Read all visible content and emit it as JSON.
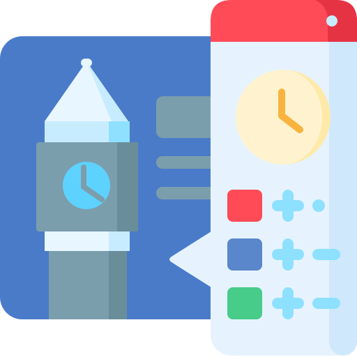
{
  "icon": {
    "name": "big-ben-time-zone-icon",
    "subject": "clock-tower-with-color-legend-panel"
  },
  "colors": {
    "card_blue": "#4a7bc9",
    "card_blue_dark": "#3f6fbf",
    "panel_bg": "#e6f3ff",
    "panel_shadow": "#cfe8fb",
    "panel_header": "#ff4b57",
    "panel_header_dark": "#e53344",
    "tower_stone": "#7b9ead",
    "tower_stone_dark": "#698e9a",
    "tower_light": "#c8ecff",
    "tower_top": "#e8f6ff",
    "clock_face": "#fff3cf",
    "clock_face_shade": "#ffe9a8",
    "clock_hands": "#f8b33e",
    "tower_clock": "#5ed2ff",
    "tower_clock_light": "#8fe0ff",
    "legend_red": "#ff4b57",
    "legend_blue": "#5a87cc",
    "legend_green": "#47cc8a",
    "plus_color": "#8ee0ff"
  },
  "legend": [
    {
      "swatch": "red",
      "marker": "plus-dot"
    },
    {
      "swatch": "blue",
      "marker": "plus-dash"
    },
    {
      "swatch": "green",
      "marker": "plus-dash"
    }
  ]
}
